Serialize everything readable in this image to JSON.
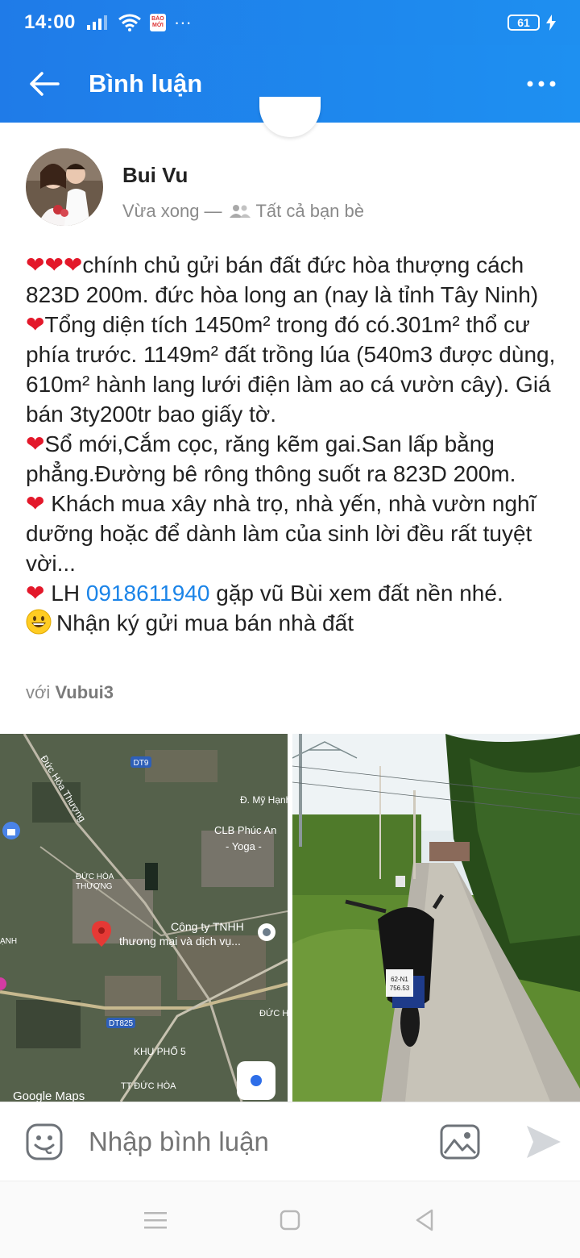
{
  "status_bar": {
    "time": "14:00",
    "battery": "61",
    "app_badge": "BÁO MỚI",
    "more": "···"
  },
  "header": {
    "title": "Bình luận"
  },
  "post": {
    "author": "Bui Vu",
    "time": "Vừa xong",
    "separator": "—",
    "privacy": "Tất cả bạn bè",
    "paragraphs": {
      "p1": "chính chủ gửi bán đất đức hòa thượng cách 823D 200m. đức hòa long an (nay là tỉnh Tây Ninh)",
      "p2": "Tổng diện tích 1450m² trong đó có.301m² thổ cư phía trước. 1149m² đất trồng lúa (540m3 được dùng, 610m² hành lang lưới điện làm ao cá vườn cây). Giá bán 3ty200tr bao giấy tờ.",
      "p3": "Sổ mới,Cắm cọc, răng kẽm gai.San lấp bằng phẳng.Đường bê rông thông suốt ra 823D 200m.",
      "p4": " Khách mua xây nhà trọ, nhà yến, nhà vườn nghĩ dưỡng hoặc để dành làm của sinh lời đều rất tuyệt vời...",
      "p5_prefix": " LH ",
      "p5_phone": "0918611940",
      "p5_suffix": " gặp vũ Bùi xem đất nền nhé.",
      "p6": "Nhận ký gửi mua bán nhà đất"
    },
    "hearts": {
      "triple": "❤❤❤",
      "single": "❤"
    },
    "tag_prefix": "với",
    "tag_user": "Vubui3"
  },
  "map_labels": {
    "dt9": "DT9",
    "duc_hoa_thuong_road": "Đức Hòa Thượng",
    "my_hanh": "Đ. Mỹ Hạnh",
    "clb": "CLB Phúc An",
    "yoga": "- Yoga -",
    "duc_hoa_thuong": "ĐỨC HÒA",
    "duc_hoa_thuong2": "THƯỢNG",
    "cong_ty": "Công ty TNHH",
    "thuong_mai": "thương mại và dịch vụ...",
    "anh": "ẠNH",
    "dt825": "DT825",
    "duc_h": "ĐỨC H",
    "khu_pho": "KHU PHỐ 5",
    "tt_duc_hoa": "TT ĐỨC HÒA",
    "google_maps": "Google Maps"
  },
  "plate": {
    "line1": "62-N1",
    "line2": "756.53"
  },
  "comment_bar": {
    "placeholder": "Nhập bình luận"
  },
  "colors": {
    "header_blue": "#1f7be8",
    "link_blue": "#1b84e8",
    "heart_red": "#e3182a"
  }
}
